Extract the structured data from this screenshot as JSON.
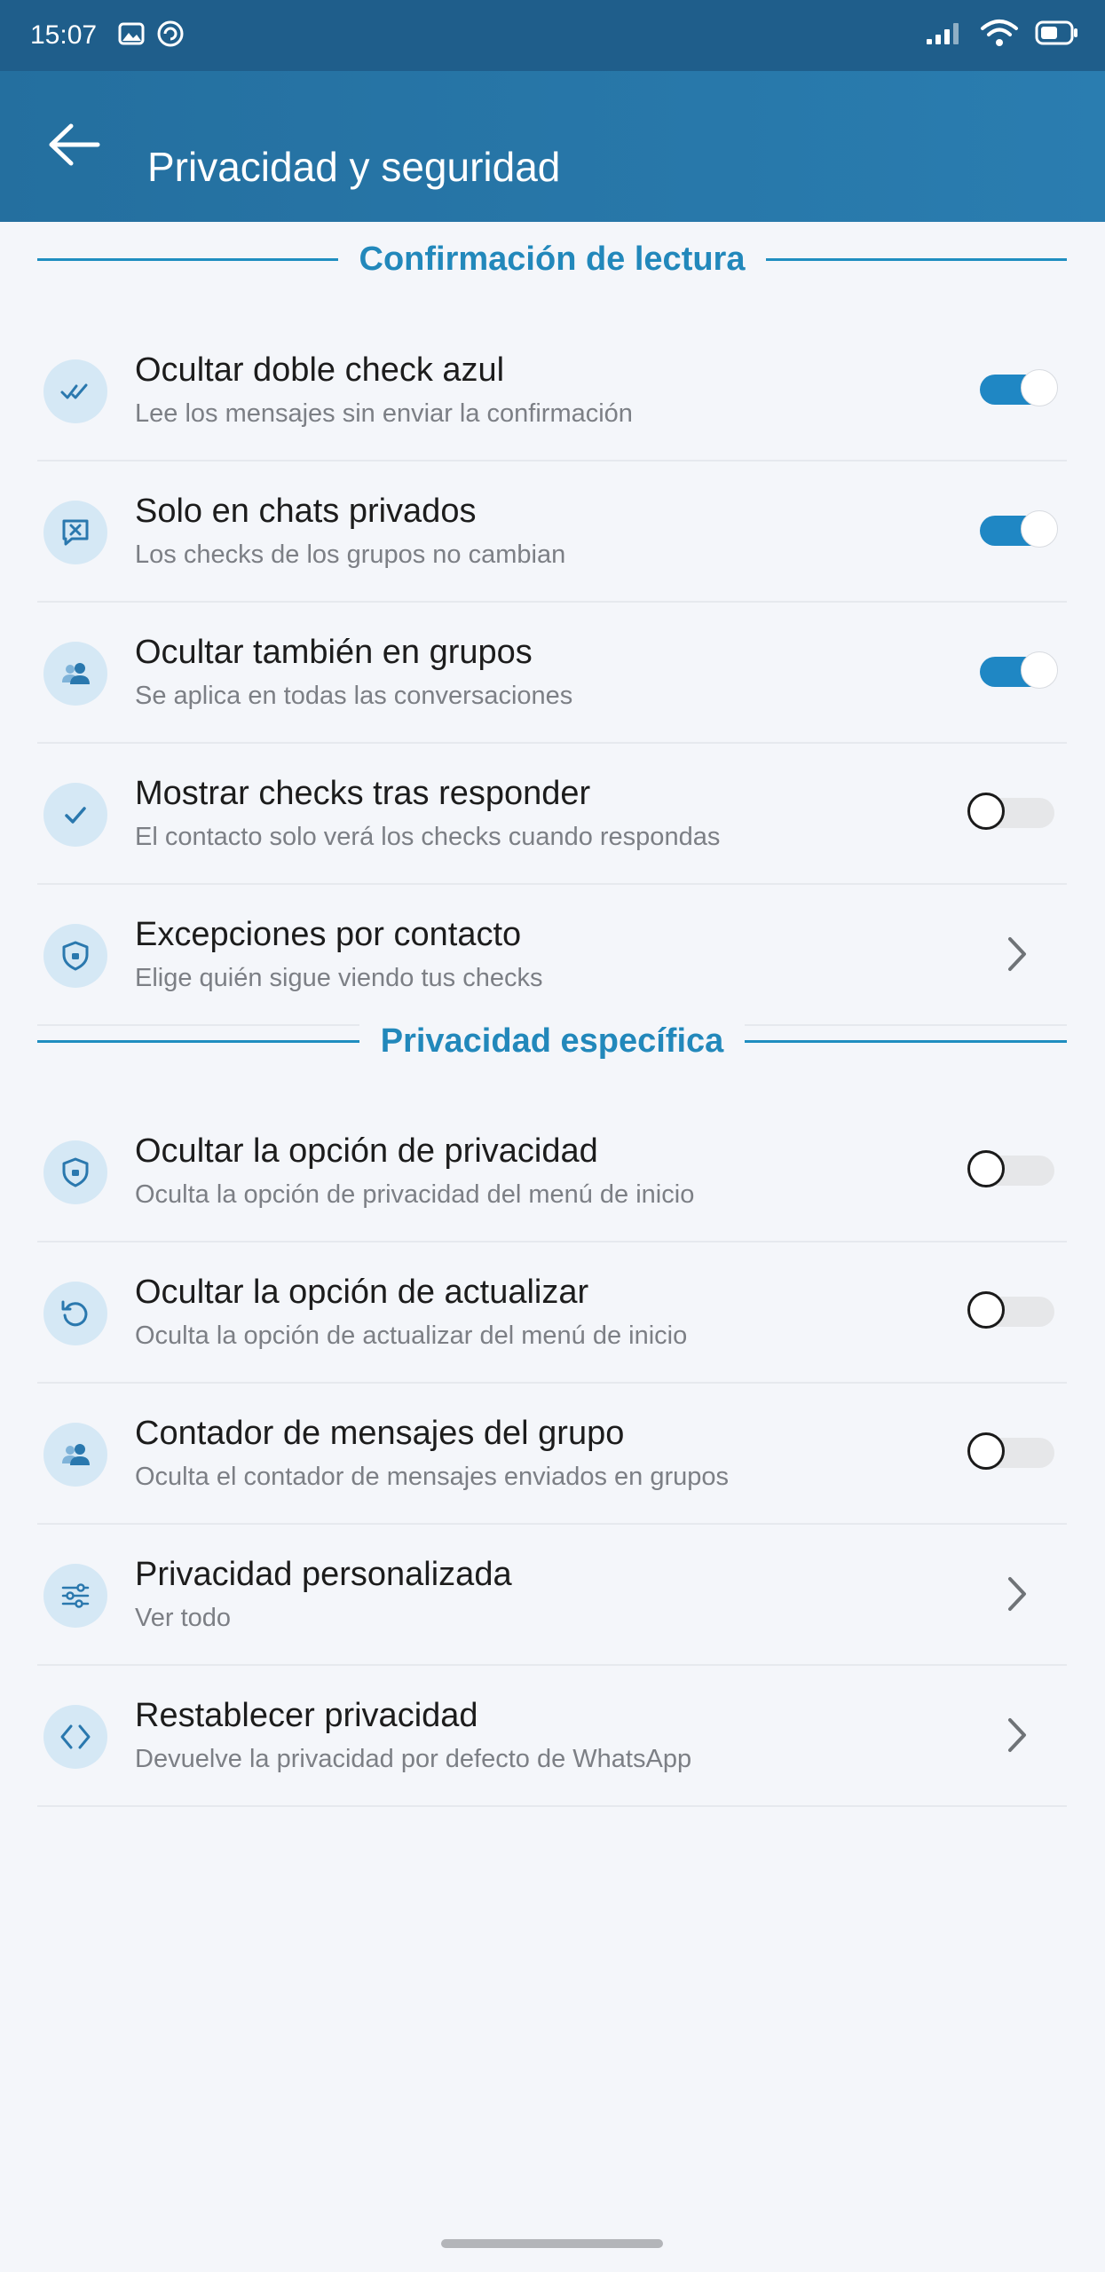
{
  "status_bar": {
    "time": "15:07",
    "left_icons": [
      "image-icon",
      "sync-icon"
    ],
    "right_icons": [
      "signal-icon",
      "wifi-icon",
      "battery-icon"
    ]
  },
  "app_bar": {
    "title": "Privacidad y seguridad",
    "back_icon": "back-arrow-icon"
  },
  "sections": [
    {
      "title": "Confirmación de lectura",
      "items": [
        {
          "icon": "double-check-icon",
          "title": "Ocultar doble check azul",
          "subtitle": "Lee los mensajes sin enviar la confirmación",
          "control": "toggle",
          "on": true
        },
        {
          "icon": "chat-x-icon",
          "title": "Solo en chats privados",
          "subtitle": "Los checks de los grupos no cambian",
          "control": "toggle",
          "on": true
        },
        {
          "icon": "group-icon",
          "title": "Ocultar también en grupos",
          "subtitle": "Se aplica en todas las conversaciones",
          "control": "toggle",
          "on": true
        },
        {
          "icon": "check-icon",
          "title": "Mostrar checks tras responder",
          "subtitle": "El contacto solo verá los checks cuando respondas",
          "control": "toggle",
          "on": false
        },
        {
          "icon": "shield-icon",
          "title": "Excepciones por contacto",
          "subtitle": "Elige quién sigue viendo tus checks",
          "control": "chevron"
        }
      ]
    },
    {
      "title": "Privacidad específica",
      "items": [
        {
          "icon": "shield-icon",
          "title": "Ocultar la opción de privacidad",
          "subtitle": "Oculta la opción de privacidad del menú de inicio",
          "control": "toggle",
          "on": false
        },
        {
          "icon": "refresh-icon",
          "title": "Ocultar la opción de actualizar",
          "subtitle": "Oculta la opción de actualizar del menú de inicio",
          "control": "toggle",
          "on": false
        },
        {
          "icon": "group-icon",
          "title": "Contador de mensajes del grupo",
          "subtitle": "Oculta el contador de mensajes enviados en grupos",
          "control": "toggle",
          "on": false
        },
        {
          "icon": "sliders-icon",
          "title": "Privacidad personalizada",
          "subtitle": "Ver todo",
          "control": "chevron"
        },
        {
          "icon": "code-icon",
          "title": "Restablecer privacidad",
          "subtitle": "Devuelve la privacidad por defecto de WhatsApp",
          "control": "chevron"
        }
      ]
    }
  ],
  "colors": {
    "status_bar": "#1f5e8b",
    "app_bar": "#2a7db0",
    "accent": "#2288bb",
    "toggle_on": "#1f87c4",
    "background": "#f4f6fa"
  }
}
